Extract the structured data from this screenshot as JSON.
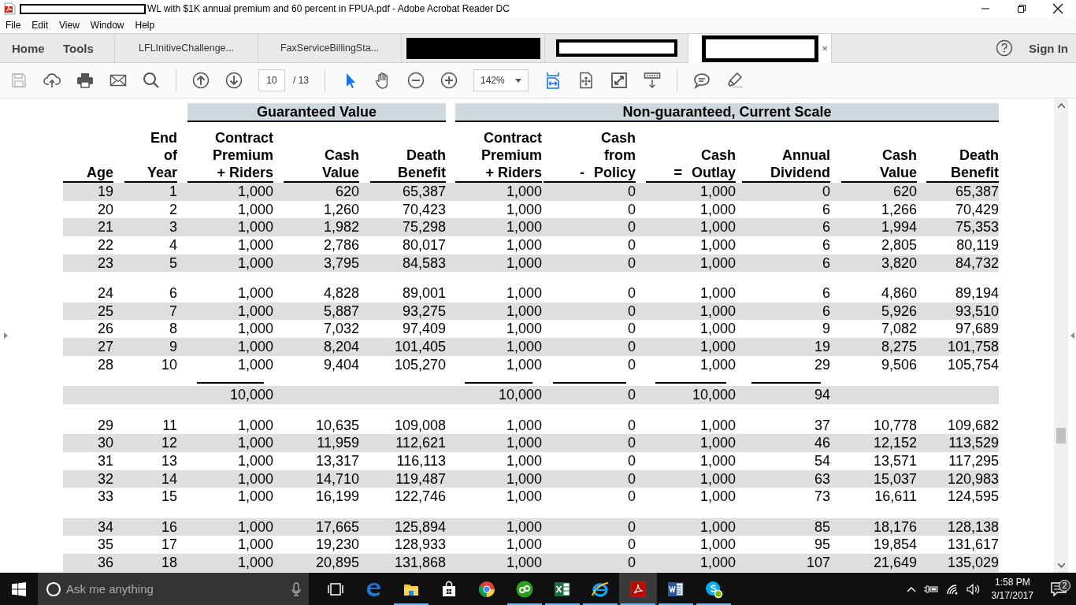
{
  "window": {
    "title": "WL with $1K annual premium and 60 percent in FPUA.pdf - Adobe Acrobat Reader DC",
    "title_prefix_redacted": true
  },
  "menu": [
    "File",
    "Edit",
    "View",
    "Window",
    "Help"
  ],
  "nav": [
    "Home",
    "Tools"
  ],
  "tabs": [
    {
      "kind": "text",
      "label": "LFLInitiveChallenge...",
      "selected": false
    },
    {
      "kind": "text",
      "label": "FaxServiceBillingSta...",
      "selected": false
    },
    {
      "kind": "redacted-fill",
      "selected": false
    },
    {
      "kind": "redacted-outline",
      "selected": false
    },
    {
      "kind": "redacted-outline",
      "selected": true,
      "close": "×"
    }
  ],
  "sign_in": "Sign In",
  "toolbar": {
    "groups": [
      [
        {
          "kind": "save",
          "disabled": true,
          "active": false
        },
        {
          "kind": "upload",
          "disabled": false,
          "active": false
        },
        {
          "kind": "print",
          "disabled": false,
          "active": false
        },
        {
          "kind": "mail",
          "disabled": false,
          "active": false
        },
        {
          "kind": "search",
          "disabled": false,
          "active": false
        }
      ],
      [
        {
          "kind": "page-up",
          "disabled": false,
          "active": false
        },
        {
          "kind": "page-down",
          "disabled": false,
          "active": false
        },
        {
          "kind": "page",
          "value": "10",
          "total": "/ 13"
        }
      ],
      [
        {
          "kind": "select",
          "disabled": false,
          "active": true
        },
        {
          "kind": "hand",
          "disabled": false,
          "active": false
        },
        {
          "kind": "zoom-out",
          "disabled": false,
          "active": false
        },
        {
          "kind": "zoom-in",
          "disabled": false,
          "active": false
        },
        {
          "kind": "zoom",
          "value": "142%"
        },
        {
          "kind": "fit-width",
          "disabled": false,
          "active": true
        },
        {
          "kind": "page-move",
          "disabled": false,
          "active": false
        },
        {
          "kind": "full-screen",
          "disabled": false,
          "active": false
        },
        {
          "kind": "read-mode",
          "disabled": false,
          "active": false
        }
      ],
      [
        {
          "kind": "comment",
          "disabled": false,
          "active": false
        },
        {
          "kind": "highlight",
          "disabled": false,
          "active": false
        }
      ]
    ]
  },
  "table": {
    "header": [
      {
        "kind": "single",
        "lines": [
          "Age"
        ]
      },
      {
        "kind": "single",
        "lines": [
          "End",
          "of",
          "Year"
        ]
      },
      {
        "kind": "group",
        "label": "Guaranteed Value",
        "columns": [
          {
            "lines": [
              "Contract",
              "Premium",
              "+ Riders"
            ]
          },
          {
            "lines": [
              "Cash",
              "Value"
            ]
          },
          {
            "lines": [
              "Death",
              "Benefit"
            ]
          }
        ]
      },
      {
        "kind": "group",
        "label": "Non-guaranteed, Current Scale",
        "columns": [
          {
            "lines": [
              "Contract",
              "Premium",
              "+ Riders"
            ]
          },
          {
            "lines": [
              "Cash",
              "from",
              "Policy"
            ],
            "sign": "-"
          },
          {
            "lines": [
              "Cash",
              "Outlay"
            ],
            "sign": "="
          },
          {
            "lines": [
              "Annual",
              "Dividend"
            ]
          },
          {
            "lines": [
              "Cash",
              "Value"
            ]
          },
          {
            "lines": [
              "Death",
              "Benefit"
            ]
          }
        ]
      }
    ],
    "rows": [
      {
        "kind": "data",
        "cells": [
          "19",
          "1",
          "1,000",
          "620",
          "65,387",
          "1,000",
          "0",
          "1,000",
          "0",
          "620",
          "65,387"
        ]
      },
      {
        "kind": "data",
        "cells": [
          "20",
          "2",
          "1,000",
          "1,260",
          "70,423",
          "1,000",
          "0",
          "1,000",
          "6",
          "1,266",
          "70,429"
        ]
      },
      {
        "kind": "data",
        "cells": [
          "21",
          "3",
          "1,000",
          "1,982",
          "75,298",
          "1,000",
          "0",
          "1,000",
          "6",
          "1,994",
          "75,353"
        ]
      },
      {
        "kind": "data",
        "cells": [
          "22",
          "4",
          "1,000",
          "2,786",
          "80,017",
          "1,000",
          "0",
          "1,000",
          "6",
          "2,805",
          "80,119"
        ]
      },
      {
        "kind": "data",
        "cells": [
          "23",
          "5",
          "1,000",
          "3,795",
          "84,583",
          "1,000",
          "0",
          "1,000",
          "6",
          "3,820",
          "84,732"
        ]
      },
      {
        "kind": "spacer"
      },
      {
        "kind": "data",
        "cells": [
          "24",
          "6",
          "1,000",
          "4,828",
          "89,001",
          "1,000",
          "0",
          "1,000",
          "6",
          "4,860",
          "89,194"
        ]
      },
      {
        "kind": "data",
        "cells": [
          "25",
          "7",
          "1,000",
          "5,887",
          "93,275",
          "1,000",
          "0",
          "1,000",
          "6",
          "5,926",
          "93,510"
        ]
      },
      {
        "kind": "data",
        "cells": [
          "26",
          "8",
          "1,000",
          "7,032",
          "97,409",
          "1,000",
          "0",
          "1,000",
          "9",
          "7,082",
          "97,689"
        ]
      },
      {
        "kind": "data",
        "cells": [
          "27",
          "9",
          "1,000",
          "8,204",
          "101,405",
          "1,000",
          "0",
          "1,000",
          "19",
          "8,275",
          "101,758"
        ]
      },
      {
        "kind": "data",
        "cells": [
          "28",
          "10",
          "1,000",
          "9,404",
          "105,270",
          "1,000",
          "0",
          "1,000",
          "29",
          "9,506",
          "105,754"
        ]
      },
      {
        "kind": "total",
        "cells": [
          null,
          null,
          "10,000",
          null,
          null,
          "10,000",
          "0",
          "10,000",
          "94",
          null,
          null
        ]
      },
      {
        "kind": "spacer"
      },
      {
        "kind": "data",
        "cells": [
          "29",
          "11",
          "1,000",
          "10,635",
          "109,008",
          "1,000",
          "0",
          "1,000",
          "37",
          "10,778",
          "109,682"
        ]
      },
      {
        "kind": "data",
        "cells": [
          "30",
          "12",
          "1,000",
          "11,959",
          "112,621",
          "1,000",
          "0",
          "1,000",
          "46",
          "12,152",
          "113,529"
        ]
      },
      {
        "kind": "data",
        "cells": [
          "31",
          "13",
          "1,000",
          "13,317",
          "116,113",
          "1,000",
          "0",
          "1,000",
          "54",
          "13,571",
          "117,295"
        ]
      },
      {
        "kind": "data",
        "cells": [
          "32",
          "14",
          "1,000",
          "14,710",
          "119,487",
          "1,000",
          "0",
          "1,000",
          "63",
          "15,037",
          "120,983"
        ]
      },
      {
        "kind": "data",
        "cells": [
          "33",
          "15",
          "1,000",
          "16,199",
          "122,746",
          "1,000",
          "0",
          "1,000",
          "73",
          "16,611",
          "124,595"
        ]
      },
      {
        "kind": "spacer"
      },
      {
        "kind": "data",
        "cells": [
          "34",
          "16",
          "1,000",
          "17,665",
          "125,894",
          "1,000",
          "0",
          "1,000",
          "85",
          "18,176",
          "128,138"
        ]
      },
      {
        "kind": "data",
        "cells": [
          "35",
          "17",
          "1,000",
          "19,230",
          "128,933",
          "1,000",
          "0",
          "1,000",
          "95",
          "19,854",
          "131,617"
        ]
      },
      {
        "kind": "data",
        "cells": [
          "36",
          "18",
          "1,000",
          "20,895",
          "131,868",
          "1,000",
          "0",
          "1,000",
          "107",
          "21,649",
          "135,029"
        ]
      }
    ]
  },
  "taskbar": {
    "search_placeholder": "Ask me anything",
    "apps": [
      {
        "kind": "task-view",
        "running": false,
        "active": false
      },
      {
        "kind": "edge",
        "running": false,
        "active": false
      },
      {
        "kind": "explorer",
        "running": true,
        "active": false
      },
      {
        "kind": "store",
        "running": false,
        "active": false
      },
      {
        "kind": "chrome",
        "running": false,
        "active": false
      },
      {
        "kind": "quickbooks",
        "running": true,
        "active": false
      },
      {
        "kind": "excel",
        "running": true,
        "active": false
      },
      {
        "kind": "ie",
        "running": true,
        "active": false
      },
      {
        "kind": "acrobat",
        "running": true,
        "active": true
      },
      {
        "kind": "word",
        "running": true,
        "active": false
      },
      {
        "kind": "skype",
        "running": true,
        "active": false
      }
    ],
    "time": "1:58 PM",
    "date": "3/17/2017",
    "notifications": "2"
  }
}
